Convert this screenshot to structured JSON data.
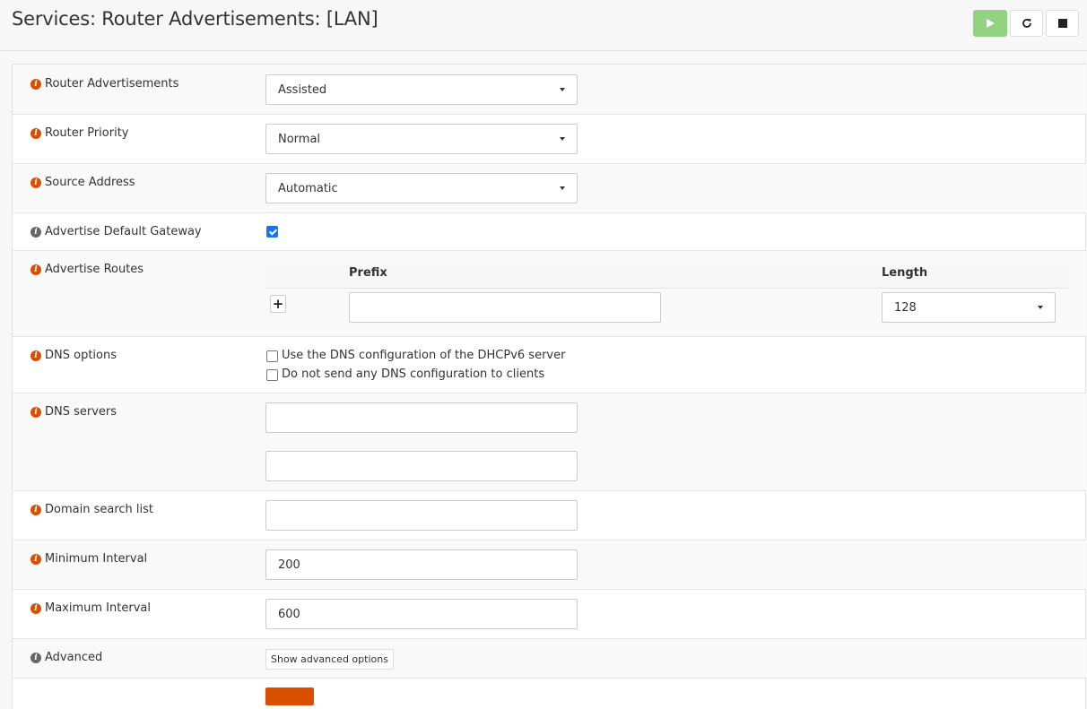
{
  "header": {
    "title": "Services: Router Advertisements: [LAN]",
    "buttons": {
      "start": "play-icon",
      "restart": "restart-icon",
      "stop": "stop-icon"
    }
  },
  "form": {
    "router_advertisements": {
      "label": "Router Advertisements",
      "value": "Assisted"
    },
    "router_priority": {
      "label": "Router Priority",
      "value": "Normal"
    },
    "source_address": {
      "label": "Source Address",
      "value": "Automatic"
    },
    "advertise_default_gateway": {
      "label": "Advertise Default Gateway",
      "checked": true
    },
    "advertise_routes": {
      "label": "Advertise Routes",
      "col_prefix": "Prefix",
      "col_length": "Length",
      "prefix_value": "",
      "length_value": "128"
    },
    "dns_options": {
      "label": "DNS options",
      "option1": "Use the DNS configuration of the DHCPv6 server",
      "option2": "Do not send any DNS configuration to clients"
    },
    "dns_servers": {
      "label": "DNS servers",
      "server1": "",
      "server2": ""
    },
    "domain_search_list": {
      "label": "Domain search list",
      "value": ""
    },
    "minimum_interval": {
      "label": "Minimum Interval",
      "value": "200"
    },
    "maximum_interval": {
      "label": "Maximum Interval",
      "value": "600"
    },
    "advanced": {
      "label": "Advanced",
      "button": "Show advanced options"
    }
  },
  "colors": {
    "accent": "#d94f00",
    "start_green": "#91d37f",
    "checkbox_blue": "#1a73e8"
  }
}
